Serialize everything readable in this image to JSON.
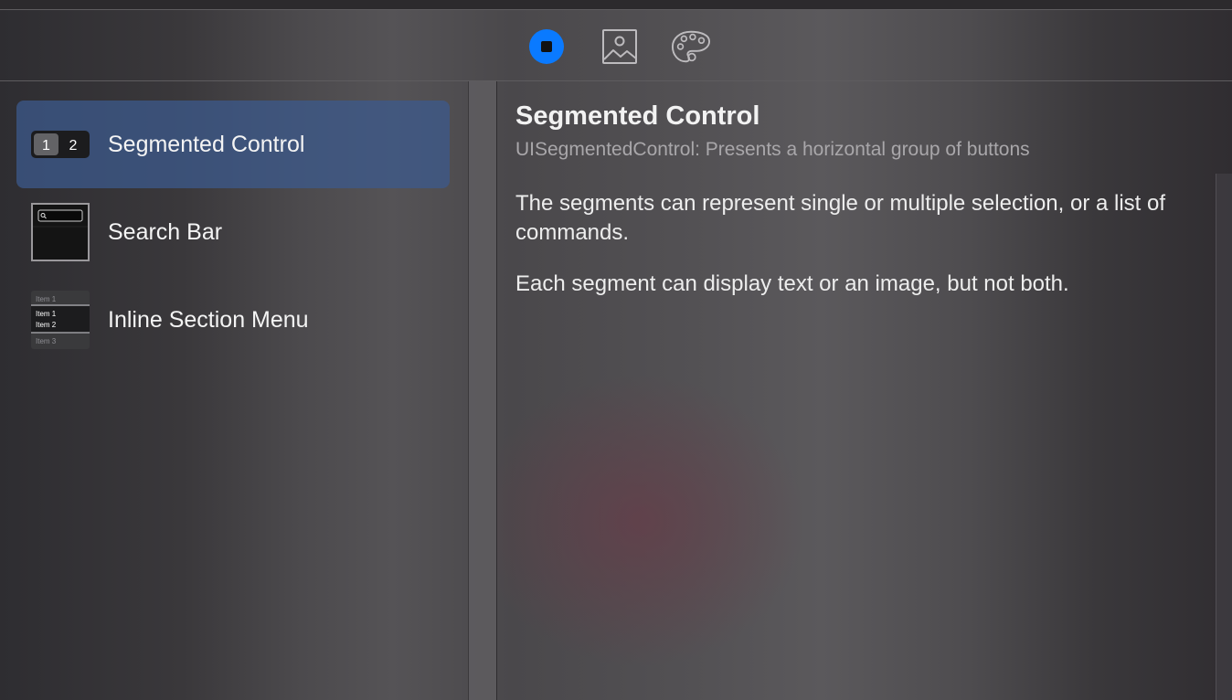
{
  "toolbar": {
    "items": [
      {
        "name": "controls",
        "icon": "stop-circle-icon",
        "active": true,
        "color": "#0a7aff"
      },
      {
        "name": "images",
        "icon": "photo-icon",
        "active": false
      },
      {
        "name": "colors",
        "icon": "palette-icon",
        "active": false
      }
    ]
  },
  "sidebar": {
    "items": [
      {
        "label": "Segmented Control",
        "selected": true,
        "thumb": {
          "seg1": "1",
          "seg2": "2"
        }
      },
      {
        "label": "Search Bar",
        "selected": false
      },
      {
        "label": "Inline Section Menu",
        "selected": false,
        "thumb": {
          "item1": "Item 1",
          "item1b": "Item 1",
          "item2": "Item 2",
          "item3": "Item 3"
        }
      }
    ]
  },
  "detail": {
    "title": "Segmented Control",
    "subtitle": "UISegmentedControl: Presents a horizontal group of buttons",
    "paragraphs": [
      "The segments can represent single or multiple selection, or a list of commands.",
      "Each segment can display text or an image, but not both."
    ]
  },
  "colors": {
    "accent": "#0a7aff",
    "selection": "#3c5a8c"
  }
}
